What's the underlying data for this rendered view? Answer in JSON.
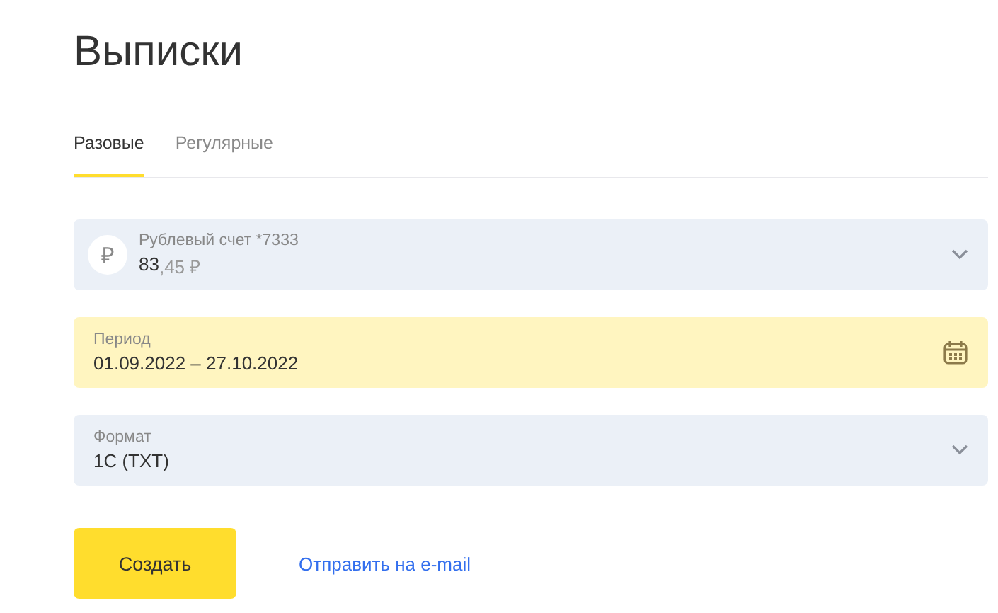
{
  "title": "Выписки",
  "tabs": [
    {
      "label": "Разовые",
      "selected": true
    },
    {
      "label": "Регулярные",
      "selected": false
    }
  ],
  "account": {
    "symbol": "₽",
    "label": "Рублевый счет *7333",
    "amount_whole": "83",
    "amount_rest": ",45 ₽"
  },
  "fields": [
    {
      "kind": "date",
      "label": "Период",
      "value": "01.09.2022 – 27.10.2022",
      "focused": true
    },
    {
      "kind": "select",
      "label": "Формат",
      "value": "1C (TXT)",
      "focused": false
    }
  ],
  "create_button": "Создать",
  "email_link": "Отправить на e-mail"
}
